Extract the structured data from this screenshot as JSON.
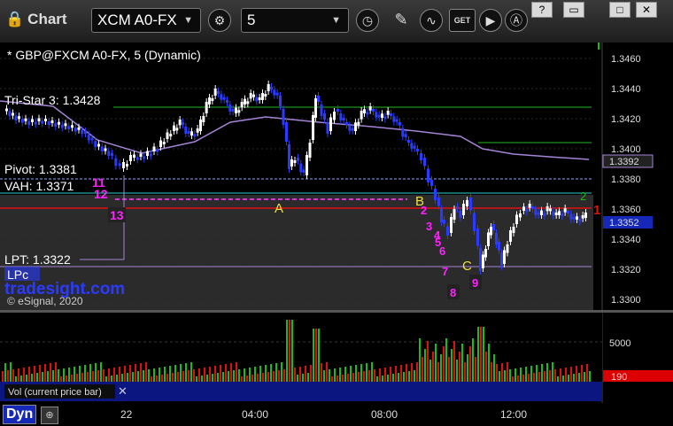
{
  "toolbar": {
    "title": "Chart",
    "symbol": "XCM A0-FX",
    "interval": "5",
    "get_label": "GET",
    "window_buttons": [
      "?",
      "▭",
      "□",
      "✕"
    ]
  },
  "chart": {
    "header": "* GBP@FXCM A0-FX, 5 (Dynamic)",
    "watermark": "tradesight.com",
    "copyright": "© eSignal, 2020",
    "levels": {
      "tristar": "Tri-Star 3: 1.3428",
      "pivot": "Pivot: 1.3381",
      "vah": "VAH: 1.3371",
      "lpt": "LPT: 1.3322",
      "lpc": "LPc"
    },
    "price_ticks": [
      "1.3460",
      "1.3440",
      "1.3420",
      "1.3400",
      "1.3380",
      "1.3360",
      "1.3340",
      "1.3320",
      "1.3300"
    ],
    "current_price_badge": "1.3352",
    "ma_badge": "1.3392",
    "volume_panel": {
      "label": "Vol (current price bar)",
      "tick": "5000",
      "badge": "190"
    },
    "time_ticks": [
      "22",
      "04:00",
      "08:00",
      "12:00"
    ],
    "annotations": {
      "A": "A",
      "B": "B",
      "C": "C",
      "seq_left": [
        "11",
        "12",
        "13"
      ],
      "seq_down": [
        "2",
        "3",
        "4",
        "5",
        "6",
        "7",
        "8",
        "9"
      ],
      "green_2": "2",
      "red_1": "1"
    },
    "colors": {
      "up_bar": "#ffffff",
      "down_bar": "#2a3bff",
      "pivot_line": "#e01010",
      "tristar_line": "#1fb81f",
      "ma_line": "#a584d6",
      "seq_color": "#ff22ff"
    }
  },
  "status": {
    "dyn_label": "Dyn"
  }
}
